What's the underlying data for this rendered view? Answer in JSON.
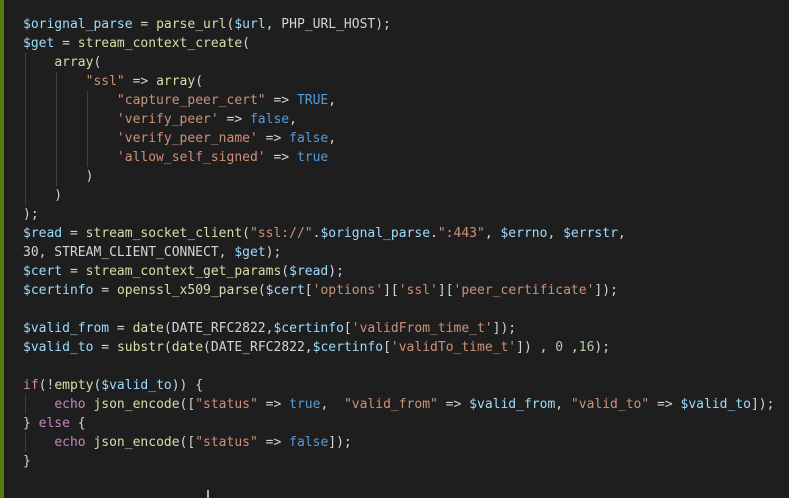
{
  "editor": {
    "language": "php",
    "colors": {
      "background": "#1e1e1e",
      "variable": "#9cdcfe",
      "function": "#dcdcaa",
      "string": "#ce9178",
      "keyword": "#c586c0",
      "boolean": "#569cd6",
      "number": "#b5cea8",
      "plain": "#d4d4d4",
      "modified_bar": "#587c0c"
    },
    "lines": [
      [
        [
          "var",
          "$orignal_parse"
        ],
        [
          "plain",
          " = "
        ],
        [
          "fn",
          "parse_url"
        ],
        [
          "plain",
          "("
        ],
        [
          "var",
          "$url"
        ],
        [
          "plain",
          ", PHP_URL_HOST);"
        ]
      ],
      [
        [
          "var",
          "$get"
        ],
        [
          "plain",
          " = "
        ],
        [
          "fn",
          "stream_context_create"
        ],
        [
          "plain",
          "("
        ]
      ],
      [
        [
          "plain",
          "    "
        ],
        [
          "fn",
          "array"
        ],
        [
          "plain",
          "("
        ]
      ],
      [
        [
          "plain",
          "        "
        ],
        [
          "str",
          "\"ssl\""
        ],
        [
          "plain",
          " => "
        ],
        [
          "fn",
          "array"
        ],
        [
          "plain",
          "("
        ]
      ],
      [
        [
          "plain",
          "            "
        ],
        [
          "str",
          "\"capture_peer_cert\""
        ],
        [
          "plain",
          " => "
        ],
        [
          "bool",
          "TRUE"
        ],
        [
          "plain",
          ","
        ]
      ],
      [
        [
          "plain",
          "            "
        ],
        [
          "str",
          "'verify_peer'"
        ],
        [
          "plain",
          " => "
        ],
        [
          "bool",
          "false"
        ],
        [
          "plain",
          ","
        ]
      ],
      [
        [
          "plain",
          "            "
        ],
        [
          "str",
          "'verify_peer_name'"
        ],
        [
          "plain",
          " => "
        ],
        [
          "bool",
          "false"
        ],
        [
          "plain",
          ","
        ]
      ],
      [
        [
          "plain",
          "            "
        ],
        [
          "str",
          "'allow_self_signed'"
        ],
        [
          "plain",
          " => "
        ],
        [
          "bool",
          "true"
        ]
      ],
      [
        [
          "plain",
          "        )"
        ]
      ],
      [
        [
          "plain",
          "    )"
        ]
      ],
      [
        [
          "plain",
          ");"
        ]
      ],
      [
        [
          "var",
          "$read"
        ],
        [
          "plain",
          " = "
        ],
        [
          "fn",
          "stream_socket_client"
        ],
        [
          "plain",
          "("
        ],
        [
          "str",
          "\"ssl://\""
        ],
        [
          "plain",
          "."
        ],
        [
          "var",
          "$orignal_parse"
        ],
        [
          "plain",
          "."
        ],
        [
          "str",
          "\":443\""
        ],
        [
          "plain",
          ", "
        ],
        [
          "var",
          "$errno"
        ],
        [
          "plain",
          ", "
        ],
        [
          "var",
          "$errstr"
        ],
        [
          "plain",
          ","
        ]
      ],
      [
        [
          "plain",
          "30, STREAM_CLIENT_CONNECT, "
        ],
        [
          "var",
          "$get"
        ],
        [
          "plain",
          ");"
        ]
      ],
      [
        [
          "var",
          "$cert"
        ],
        [
          "plain",
          " = "
        ],
        [
          "fn",
          "stream_context_get_params"
        ],
        [
          "plain",
          "("
        ],
        [
          "var",
          "$read"
        ],
        [
          "plain",
          ");"
        ]
      ],
      [
        [
          "var",
          "$certinfo"
        ],
        [
          "plain",
          " = "
        ],
        [
          "fn",
          "openssl_x509_parse"
        ],
        [
          "plain",
          "("
        ],
        [
          "var",
          "$cert"
        ],
        [
          "plain",
          "["
        ],
        [
          "str",
          "'options'"
        ],
        [
          "plain",
          "]["
        ],
        [
          "str",
          "'ssl'"
        ],
        [
          "plain",
          "]["
        ],
        [
          "str",
          "'peer_certificate'"
        ],
        [
          "plain",
          "]);"
        ]
      ],
      [],
      [
        [
          "var",
          "$valid_from"
        ],
        [
          "plain",
          " = "
        ],
        [
          "fn",
          "date"
        ],
        [
          "plain",
          "(DATE_RFC2822,"
        ],
        [
          "var",
          "$certinfo"
        ],
        [
          "plain",
          "["
        ],
        [
          "str",
          "'validFrom_time_t'"
        ],
        [
          "plain",
          "]);"
        ]
      ],
      [
        [
          "var",
          "$valid_to"
        ],
        [
          "plain",
          " = "
        ],
        [
          "fn",
          "substr"
        ],
        [
          "plain",
          "("
        ],
        [
          "fn",
          "date"
        ],
        [
          "plain",
          "(DATE_RFC2822,"
        ],
        [
          "var",
          "$certinfo"
        ],
        [
          "plain",
          "["
        ],
        [
          "str",
          "'validTo_time_t'"
        ],
        [
          "plain",
          "]) , "
        ],
        [
          "num",
          "0"
        ],
        [
          "plain",
          " ,"
        ],
        [
          "num",
          "16"
        ],
        [
          "plain",
          ");"
        ]
      ],
      [],
      [
        [
          "kw",
          "if"
        ],
        [
          "plain",
          "(!"
        ],
        [
          "fn",
          "empty"
        ],
        [
          "plain",
          "("
        ],
        [
          "var",
          "$valid_to"
        ],
        [
          "plain",
          ")) {"
        ]
      ],
      [
        [
          "plain",
          "    "
        ],
        [
          "kw",
          "echo"
        ],
        [
          "plain",
          " "
        ],
        [
          "fn",
          "json_encode"
        ],
        [
          "plain",
          "(["
        ],
        [
          "str",
          "\"status\""
        ],
        [
          "plain",
          " => "
        ],
        [
          "bool",
          "true"
        ],
        [
          "plain",
          ",  "
        ],
        [
          "str",
          "\"valid_from\""
        ],
        [
          "plain",
          " => "
        ],
        [
          "var",
          "$valid_from"
        ],
        [
          "plain",
          ", "
        ],
        [
          "str",
          "\"valid_to\""
        ],
        [
          "plain",
          " => "
        ],
        [
          "var",
          "$valid_to"
        ],
        [
          "plain",
          "]);"
        ]
      ],
      [
        [
          "plain",
          "} "
        ],
        [
          "kw",
          "else"
        ],
        [
          "plain",
          " {"
        ]
      ],
      [
        [
          "plain",
          "    "
        ],
        [
          "kw",
          "echo"
        ],
        [
          "plain",
          " "
        ],
        [
          "fn",
          "json_encode"
        ],
        [
          "plain",
          "(["
        ],
        [
          "str",
          "\"status\""
        ],
        [
          "plain",
          " => "
        ],
        [
          "bool",
          "false"
        ],
        [
          "plain",
          "]);"
        ]
      ],
      [
        [
          "plain",
          "}"
        ]
      ]
    ]
  }
}
